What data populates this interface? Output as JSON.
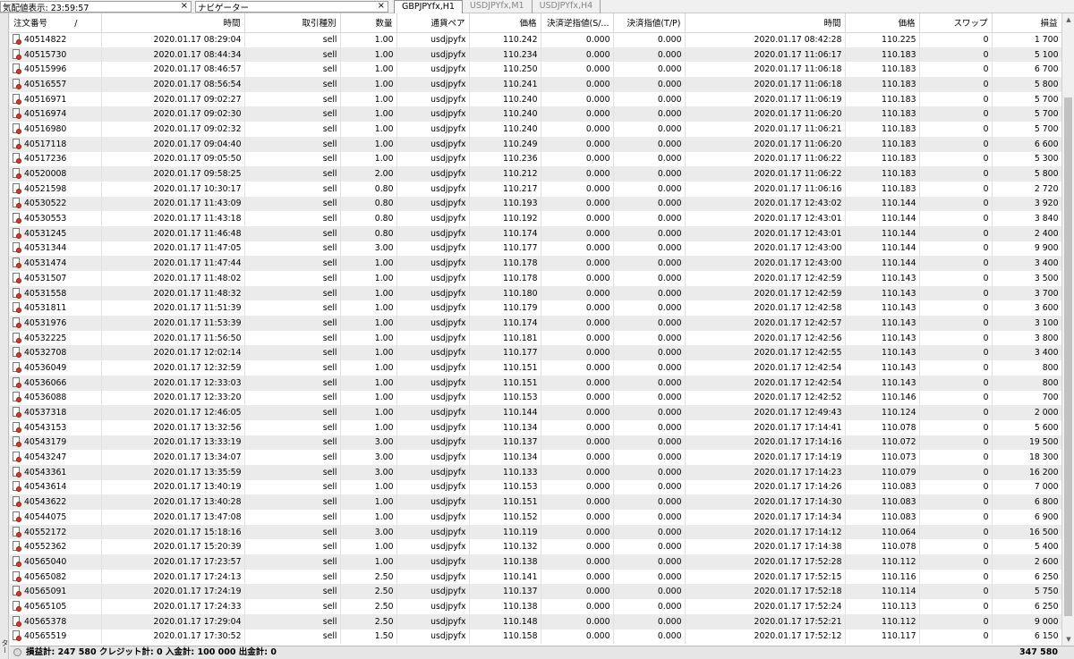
{
  "panes": {
    "quote": {
      "label": "気配値表示: 23:59:57",
      "close": "×"
    },
    "navigator": {
      "label": "ナビゲーター",
      "close": "×"
    }
  },
  "chart_tabs": [
    "GBPJPYfx,H1",
    "USDJPYfx,M1",
    "USDJPYfx,H4"
  ],
  "table": {
    "headers": [
      "注文番号",
      "時間",
      "取引種別",
      "数量",
      "通貨ペア",
      "価格",
      "決済逆指値(S/...",
      "決済指値(T/P)",
      "時間",
      "価格",
      "スワップ",
      "損益"
    ],
    "sort_mark": "/",
    "rows": [
      [
        "40514822",
        "2020.01.17 08:29:04",
        "sell",
        "1.00",
        "usdjpyfx",
        "110.242",
        "0.000",
        "0.000",
        "2020.01.17 08:42:28",
        "110.225",
        "0",
        "1 700"
      ],
      [
        "40515730",
        "2020.01.17 08:44:34",
        "sell",
        "1.00",
        "usdjpyfx",
        "110.234",
        "0.000",
        "0.000",
        "2020.01.17 11:06:17",
        "110.183",
        "0",
        "5 100"
      ],
      [
        "40515996",
        "2020.01.17 08:46:57",
        "sell",
        "1.00",
        "usdjpyfx",
        "110.250",
        "0.000",
        "0.000",
        "2020.01.17 11:06:18",
        "110.183",
        "0",
        "6 700"
      ],
      [
        "40516557",
        "2020.01.17 08:56:54",
        "sell",
        "1.00",
        "usdjpyfx",
        "110.241",
        "0.000",
        "0.000",
        "2020.01.17 11:06:18",
        "110.183",
        "0",
        "5 800"
      ],
      [
        "40516971",
        "2020.01.17 09:02:27",
        "sell",
        "1.00",
        "usdjpyfx",
        "110.240",
        "0.000",
        "0.000",
        "2020.01.17 11:06:19",
        "110.183",
        "0",
        "5 700"
      ],
      [
        "40516974",
        "2020.01.17 09:02:30",
        "sell",
        "1.00",
        "usdjpyfx",
        "110.240",
        "0.000",
        "0.000",
        "2020.01.17 11:06:20",
        "110.183",
        "0",
        "5 700"
      ],
      [
        "40516980",
        "2020.01.17 09:02:32",
        "sell",
        "1.00",
        "usdjpyfx",
        "110.240",
        "0.000",
        "0.000",
        "2020.01.17 11:06:21",
        "110.183",
        "0",
        "5 700"
      ],
      [
        "40517118",
        "2020.01.17 09:04:40",
        "sell",
        "1.00",
        "usdjpyfx",
        "110.249",
        "0.000",
        "0.000",
        "2020.01.17 11:06:20",
        "110.183",
        "0",
        "6 600"
      ],
      [
        "40517236",
        "2020.01.17 09:05:50",
        "sell",
        "1.00",
        "usdjpyfx",
        "110.236",
        "0.000",
        "0.000",
        "2020.01.17 11:06:22",
        "110.183",
        "0",
        "5 300"
      ],
      [
        "40520008",
        "2020.01.17 09:58:25",
        "sell",
        "2.00",
        "usdjpyfx",
        "110.212",
        "0.000",
        "0.000",
        "2020.01.17 11:06:22",
        "110.183",
        "0",
        "5 800"
      ],
      [
        "40521598",
        "2020.01.17 10:30:17",
        "sell",
        "0.80",
        "usdjpyfx",
        "110.217",
        "0.000",
        "0.000",
        "2020.01.17 11:06:16",
        "110.183",
        "0",
        "2 720"
      ],
      [
        "40530522",
        "2020.01.17 11:43:09",
        "sell",
        "0.80",
        "usdjpyfx",
        "110.193",
        "0.000",
        "0.000",
        "2020.01.17 12:43:02",
        "110.144",
        "0",
        "3 920"
      ],
      [
        "40530553",
        "2020.01.17 11:43:18",
        "sell",
        "0.80",
        "usdjpyfx",
        "110.192",
        "0.000",
        "0.000",
        "2020.01.17 12:43:01",
        "110.144",
        "0",
        "3 840"
      ],
      [
        "40531245",
        "2020.01.17 11:46:48",
        "sell",
        "0.80",
        "usdjpyfx",
        "110.174",
        "0.000",
        "0.000",
        "2020.01.17 12:43:01",
        "110.144",
        "0",
        "2 400"
      ],
      [
        "40531344",
        "2020.01.17 11:47:05",
        "sell",
        "3.00",
        "usdjpyfx",
        "110.177",
        "0.000",
        "0.000",
        "2020.01.17 12:43:00",
        "110.144",
        "0",
        "9 900"
      ],
      [
        "40531474",
        "2020.01.17 11:47:44",
        "sell",
        "1.00",
        "usdjpyfx",
        "110.178",
        "0.000",
        "0.000",
        "2020.01.17 12:43:00",
        "110.144",
        "0",
        "3 400"
      ],
      [
        "40531507",
        "2020.01.17 11:48:02",
        "sell",
        "1.00",
        "usdjpyfx",
        "110.178",
        "0.000",
        "0.000",
        "2020.01.17 12:42:59",
        "110.143",
        "0",
        "3 500"
      ],
      [
        "40531558",
        "2020.01.17 11:48:32",
        "sell",
        "1.00",
        "usdjpyfx",
        "110.180",
        "0.000",
        "0.000",
        "2020.01.17 12:42:59",
        "110.143",
        "0",
        "3 700"
      ],
      [
        "40531811",
        "2020.01.17 11:51:39",
        "sell",
        "1.00",
        "usdjpyfx",
        "110.179",
        "0.000",
        "0.000",
        "2020.01.17 12:42:58",
        "110.143",
        "0",
        "3 600"
      ],
      [
        "40531976",
        "2020.01.17 11:53:39",
        "sell",
        "1.00",
        "usdjpyfx",
        "110.174",
        "0.000",
        "0.000",
        "2020.01.17 12:42:57",
        "110.143",
        "0",
        "3 100"
      ],
      [
        "40532225",
        "2020.01.17 11:56:50",
        "sell",
        "1.00",
        "usdjpyfx",
        "110.181",
        "0.000",
        "0.000",
        "2020.01.17 12:42:56",
        "110.143",
        "0",
        "3 800"
      ],
      [
        "40532708",
        "2020.01.17 12:02:14",
        "sell",
        "1.00",
        "usdjpyfx",
        "110.177",
        "0.000",
        "0.000",
        "2020.01.17 12:42:55",
        "110.143",
        "0",
        "3 400"
      ],
      [
        "40536049",
        "2020.01.17 12:32:59",
        "sell",
        "1.00",
        "usdjpyfx",
        "110.151",
        "0.000",
        "0.000",
        "2020.01.17 12:42:54",
        "110.143",
        "0",
        "800"
      ],
      [
        "40536066",
        "2020.01.17 12:33:03",
        "sell",
        "1.00",
        "usdjpyfx",
        "110.151",
        "0.000",
        "0.000",
        "2020.01.17 12:42:54",
        "110.143",
        "0",
        "800"
      ],
      [
        "40536088",
        "2020.01.17 12:33:20",
        "sell",
        "1.00",
        "usdjpyfx",
        "110.153",
        "0.000",
        "0.000",
        "2020.01.17 12:42:52",
        "110.146",
        "0",
        "700"
      ],
      [
        "40537318",
        "2020.01.17 12:46:05",
        "sell",
        "1.00",
        "usdjpyfx",
        "110.144",
        "0.000",
        "0.000",
        "2020.01.17 12:49:43",
        "110.124",
        "0",
        "2 000"
      ],
      [
        "40543153",
        "2020.01.17 13:32:56",
        "sell",
        "1.00",
        "usdjpyfx",
        "110.134",
        "0.000",
        "0.000",
        "2020.01.17 17:14:41",
        "110.078",
        "0",
        "5 600"
      ],
      [
        "40543179",
        "2020.01.17 13:33:19",
        "sell",
        "3.00",
        "usdjpyfx",
        "110.137",
        "0.000",
        "0.000",
        "2020.01.17 17:14:16",
        "110.072",
        "0",
        "19 500"
      ],
      [
        "40543247",
        "2020.01.17 13:34:07",
        "sell",
        "3.00",
        "usdjpyfx",
        "110.134",
        "0.000",
        "0.000",
        "2020.01.17 17:14:19",
        "110.073",
        "0",
        "18 300"
      ],
      [
        "40543361",
        "2020.01.17 13:35:59",
        "sell",
        "3.00",
        "usdjpyfx",
        "110.133",
        "0.000",
        "0.000",
        "2020.01.17 17:14:23",
        "110.079",
        "0",
        "16 200"
      ],
      [
        "40543614",
        "2020.01.17 13:40:19",
        "sell",
        "1.00",
        "usdjpyfx",
        "110.153",
        "0.000",
        "0.000",
        "2020.01.17 17:14:26",
        "110.083",
        "0",
        "7 000"
      ],
      [
        "40543622",
        "2020.01.17 13:40:28",
        "sell",
        "1.00",
        "usdjpyfx",
        "110.151",
        "0.000",
        "0.000",
        "2020.01.17 17:14:30",
        "110.083",
        "0",
        "6 800"
      ],
      [
        "40544075",
        "2020.01.17 13:47:08",
        "sell",
        "1.00",
        "usdjpyfx",
        "110.152",
        "0.000",
        "0.000",
        "2020.01.17 17:14:34",
        "110.083",
        "0",
        "6 900"
      ],
      [
        "40552172",
        "2020.01.17 15:18:16",
        "sell",
        "3.00",
        "usdjpyfx",
        "110.119",
        "0.000",
        "0.000",
        "2020.01.17 17:14:12",
        "110.064",
        "0",
        "16 500"
      ],
      [
        "40552362",
        "2020.01.17 15:20:39",
        "sell",
        "1.00",
        "usdjpyfx",
        "110.132",
        "0.000",
        "0.000",
        "2020.01.17 17:14:38",
        "110.078",
        "0",
        "5 400"
      ],
      [
        "40565040",
        "2020.01.17 17:23:57",
        "sell",
        "1.00",
        "usdjpyfx",
        "110.138",
        "0.000",
        "0.000",
        "2020.01.17 17:52:28",
        "110.112",
        "0",
        "2 600"
      ],
      [
        "40565082",
        "2020.01.17 17:24:13",
        "sell",
        "2.50",
        "usdjpyfx",
        "110.141",
        "0.000",
        "0.000",
        "2020.01.17 17:52:15",
        "110.116",
        "0",
        "6 250"
      ],
      [
        "40565091",
        "2020.01.17 17:24:19",
        "sell",
        "2.50",
        "usdjpyfx",
        "110.137",
        "0.000",
        "0.000",
        "2020.01.17 17:52:18",
        "110.114",
        "0",
        "5 750"
      ],
      [
        "40565105",
        "2020.01.17 17:24:33",
        "sell",
        "2.50",
        "usdjpyfx",
        "110.138",
        "0.000",
        "0.000",
        "2020.01.17 17:52:24",
        "110.113",
        "0",
        "6 250"
      ],
      [
        "40565378",
        "2020.01.17 17:29:04",
        "sell",
        "2.50",
        "usdjpyfx",
        "110.148",
        "0.000",
        "0.000",
        "2020.01.17 17:52:21",
        "110.112",
        "0",
        "9 000"
      ],
      [
        "40565519",
        "2020.01.17 17:30:52",
        "sell",
        "1.50",
        "usdjpyfx",
        "110.158",
        "0.000",
        "0.000",
        "2020.01.17 17:52:12",
        "110.117",
        "0",
        "6 150"
      ]
    ]
  },
  "status": {
    "summary": "損益計: 247 580  クレジット計: 0  入金計: 100 000  出金計: 0",
    "total": "347 580"
  },
  "side_text": "ター"
}
